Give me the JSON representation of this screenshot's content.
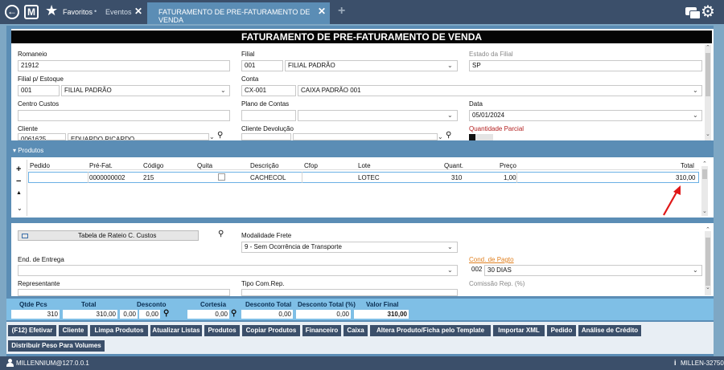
{
  "topbar": {
    "favorites": "Favoritos",
    "favorites_caret": "•",
    "tab_eventos": "Eventos",
    "tab_active": "FATURAMENTO DE PRE-FATURAMENTO DE VENDA",
    "close_glyph": "✕",
    "add_tab": "+"
  },
  "page_title": "FATURAMENTO DE PRE-FATURAMENTO DE VENDA",
  "header_form": {
    "romaneio_label": "Romaneio",
    "romaneio_value": "21912",
    "filial_label": "Filial",
    "filial_code": "001",
    "filial_name": "FILIAL PADRÃO",
    "estado_label": "Estado da Filial",
    "estado_value": "SP",
    "filial_estoque_label": "Filial p/ Estoque",
    "filial_estoque_code": "001",
    "filial_estoque_name": "FILIAL PADRÃO",
    "conta_label": "Conta",
    "conta_code": "CX-001",
    "conta_name": "CAIXA PADRÃO 001",
    "centro_label": "Centro Custos",
    "plano_label": "Plano de Contas",
    "data_label": "Data",
    "data_value": "05/01/2024",
    "cliente_label": "Cliente",
    "cliente_code": "0061625",
    "cliente_name": "EDUARDO RICARDO",
    "cliente_dev_label": "Cliente Devolução",
    "qtd_parcial_label": "Quantidade Parcial"
  },
  "produtos": {
    "section_label": "▾ Produtos",
    "side_plus": "+",
    "side_minus": "−",
    "side_up": "▲",
    "side_down": "⌄",
    "columns": [
      "Pedido",
      "Pré-Fat.",
      "Código",
      "Quita",
      "Descrição",
      "Cfop",
      "Lote",
      "Quant.",
      "Preço",
      "Total"
    ],
    "rows": [
      {
        "pedido": "",
        "prefat": "0000000002",
        "codigo": "215",
        "quita": "",
        "descricao": "CACHECOL",
        "cfop": "",
        "lote": "LOTEC",
        "quant": "310",
        "preco": "1,00",
        "total": "310,00"
      }
    ]
  },
  "lower_form": {
    "rateio_label": "Tabela de Rateio C. Custos",
    "modalidade_label": "Modalidade Frete",
    "modalidade_value": "9 - Sem Ocorrência de Transporte",
    "endereco_label": "End. de Entrega",
    "cond_label": "Cond. de Pagto",
    "cond_code": "002",
    "cond_name": "30 DIAS",
    "representante_label": "Representante",
    "tipo_com_label": "Tipo Com.Rep.",
    "comissao_label": "Comissão Rep. (%)"
  },
  "totals": {
    "qtde_label": "Qtde Pcs",
    "qtde_value": "310",
    "total_label": "Total",
    "total_value": "310,00",
    "desconto_label": "Desconto",
    "desconto_v1": "0,00",
    "desconto_v2": "0,00",
    "cortesia_label": "Cortesia",
    "cortesia_value": "0,00",
    "desc_total_label": "Desconto Total",
    "desc_total_value": "0,00",
    "desc_total_pct_label": "Desconto Total (%)",
    "desc_total_pct_value": "0,00",
    "valor_final_label": "Valor Final",
    "valor_final_value": "310,00"
  },
  "buttons": {
    "efetivar": "(F12) Efetivar",
    "cliente": "Cliente",
    "limpa": "Limpa Produtos",
    "atualizar": "Atualizar Listas",
    "produtos": "Produtos",
    "copiar": "Copiar Produtos",
    "financeiro": "Financeiro",
    "caixa": "Caixa",
    "altera": "Altera Produto/Ficha pelo Template",
    "importar": "Importar XML",
    "pedido": "Pedido",
    "analise": "Análise de Crédito",
    "distribuir": "Distribuir Peso Para Volumes"
  },
  "footer": {
    "user": "MILLENNIUM@127.0.0.1",
    "server": "MILLEN-32750"
  },
  "colors": {
    "header_bg": "#3b4f6a",
    "accent": "#5b8db5",
    "totals_bar": "#7fbfe6",
    "annotation_arrow": "#e01818"
  }
}
